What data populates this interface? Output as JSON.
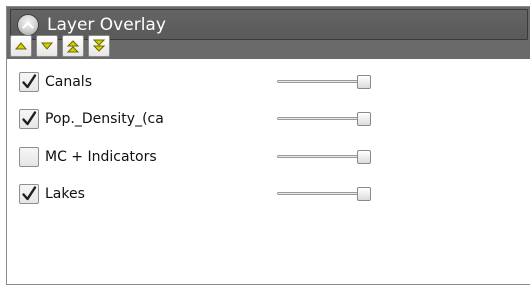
{
  "panel": {
    "title": "Layer Overlay",
    "collapse_icon": "chevron-up-icon",
    "toolbar": [
      {
        "name": "move-up-button",
        "icon": "triangle-up-icon"
      },
      {
        "name": "move-down-button",
        "icon": "triangle-down-icon"
      },
      {
        "name": "move-to-top-button",
        "icon": "double-triangle-up-icon"
      },
      {
        "name": "move-to-bottom-button",
        "icon": "double-triangle-down-icon"
      }
    ],
    "accent_color": "#d8d000"
  },
  "layers": [
    {
      "label": "Canals",
      "checked": true,
      "opacity": 1.0
    },
    {
      "label": "Pop._Density_(ca",
      "checked": true,
      "opacity": 1.0
    },
    {
      "label": "MC + Indicators",
      "checked": false,
      "opacity": 1.0
    },
    {
      "label": "Lakes",
      "checked": true,
      "opacity": 1.0
    }
  ]
}
